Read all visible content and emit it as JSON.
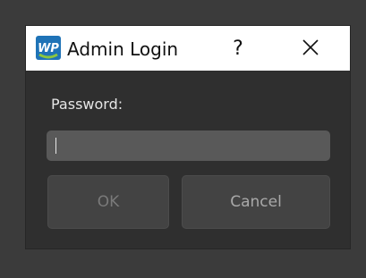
{
  "dialog": {
    "title": "Admin Login",
    "app_icon": "wp-logo-icon",
    "help_label": "?",
    "close_icon": "close-icon"
  },
  "form": {
    "password_label": "Password:",
    "password_value": ""
  },
  "buttons": {
    "ok_label": "OK",
    "cancel_label": "Cancel"
  },
  "colors": {
    "backdrop": "#3b3b3b",
    "dialog_bg": "#2f2f2f",
    "titlebar_bg": "#ffffff",
    "field_bg": "#595959",
    "button_bg": "#434343",
    "logo_blue": "#1f73b7",
    "logo_green": "#8cc63f"
  }
}
